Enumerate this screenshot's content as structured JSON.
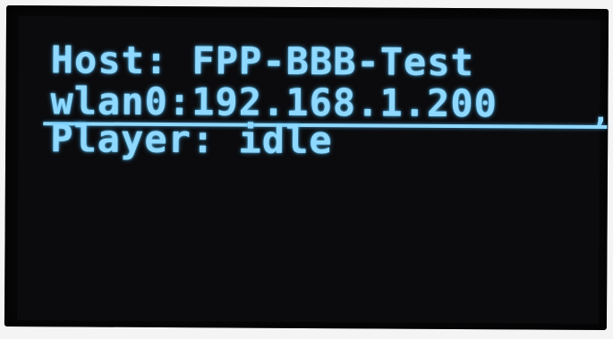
{
  "display": {
    "host_line": "Host: FPP-BBB-Test",
    "ip_line": "wlan0:192.168.1.200",
    "status_glyph": ",",
    "player_line": "Player: idle",
    "text_color": "#8fd8ff",
    "background_color": "#0b0b0d"
  }
}
